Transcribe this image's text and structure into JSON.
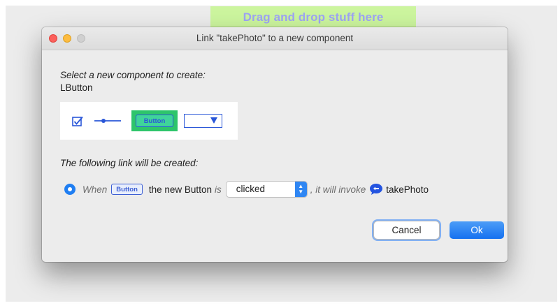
{
  "drop_banner": {
    "text": "Drag and drop stuff here"
  },
  "dialog": {
    "title": "Link \"takePhoto\" to a new component",
    "select_label": "Select a new component to create:",
    "component_name": "LButton",
    "palette": {
      "items": [
        "checkbox-icon",
        "slider-icon",
        "button-icon",
        "dropdown-icon"
      ],
      "button_label": "Button",
      "selected_item": "button-icon"
    },
    "following_label": "The following link will be created:",
    "link": {
      "when": "When",
      "badge": "Button",
      "subject": "the new Button",
      "is": "is",
      "event_value": "clicked",
      "invoke": ", it will invoke",
      "target": "takePhoto"
    },
    "cancel_label": "Cancel",
    "ok_label": "Ok"
  },
  "colors": {
    "accent": "#1f7ef2",
    "banner_bg": "#ccf59e",
    "banner_text": "#9ea4f4",
    "palette_selected": "#2ec56b",
    "component_blue": "#2a57d8"
  }
}
